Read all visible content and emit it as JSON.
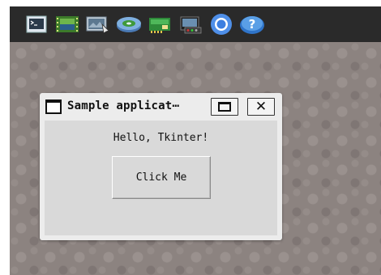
{
  "taskbar": {
    "icons": [
      {
        "name": "terminal-icon"
      },
      {
        "name": "film-strip-icon"
      },
      {
        "name": "photo-viewer-icon"
      },
      {
        "name": "disc-drive-icon"
      },
      {
        "name": "network-card-icon"
      },
      {
        "name": "media-player-icon"
      },
      {
        "name": "chromium-icon"
      },
      {
        "name": "help-icon"
      }
    ]
  },
  "window": {
    "title": "Sample applicat⋯",
    "greeting": "Hello, Tkinter!",
    "button_label": "Click Me",
    "close_glyph": "✕"
  },
  "colors": {
    "desktop": "#8c8380",
    "taskbar": "#2a2a2a",
    "window": "#ececec",
    "client": "#d9d9d9"
  }
}
